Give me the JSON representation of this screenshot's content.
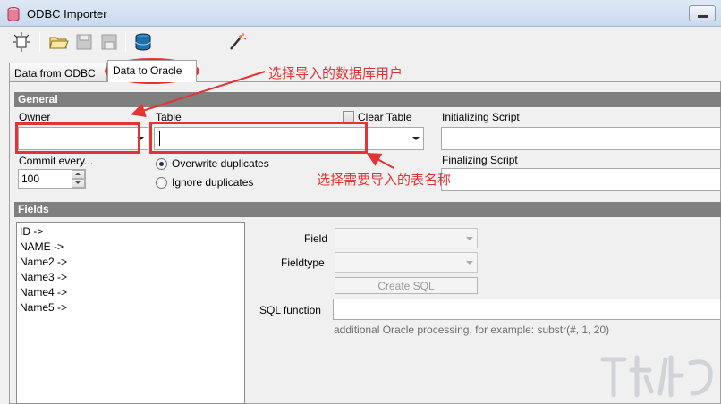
{
  "window": {
    "title": "ODBC Importer",
    "icon": "database-icon"
  },
  "toolbar": {
    "buttons": [
      {
        "name": "new-icon"
      },
      {
        "name": "open-folder-icon"
      },
      {
        "name": "save-icon"
      },
      {
        "name": "save-as-icon"
      },
      {
        "name": "database-connect-icon"
      },
      {
        "name": "magic-wand-icon"
      }
    ]
  },
  "tabs": [
    {
      "label": "Data from ODBC",
      "active": false
    },
    {
      "label": "Data to Oracle",
      "active": true
    }
  ],
  "general": {
    "header": "General",
    "owner_label": "Owner",
    "owner_value": "",
    "table_label": "Table",
    "table_value": "",
    "clear_table_label": "Clear Table",
    "clear_table_checked": false,
    "init_script_label": "Initializing Script",
    "init_script_value": "",
    "final_script_label": "Finalizing Script",
    "commit_label": "Commit every...",
    "commit_value": "100",
    "overwrite_label": "Overwrite duplicates",
    "ignore_label": "Ignore duplicates",
    "duplicates_mode": "overwrite"
  },
  "fields": {
    "header": "Fields",
    "items": [
      "ID ->",
      "NAME ->",
      "Name2 ->",
      "Name3 ->",
      "Name4 ->",
      "Name5 ->"
    ],
    "field_label": "Field",
    "fieldtype_label": "Fieldtype",
    "create_sql_label": "Create SQL",
    "sql_function_label": "SQL function",
    "sql_function_value": "",
    "hint": "additional Oracle processing, for example: substr(#, 1, 20)"
  },
  "annotations": {
    "owner_note": "选择导入的数据库用户",
    "table_note": "选择需要导入的表名称",
    "color": "#e53333"
  }
}
